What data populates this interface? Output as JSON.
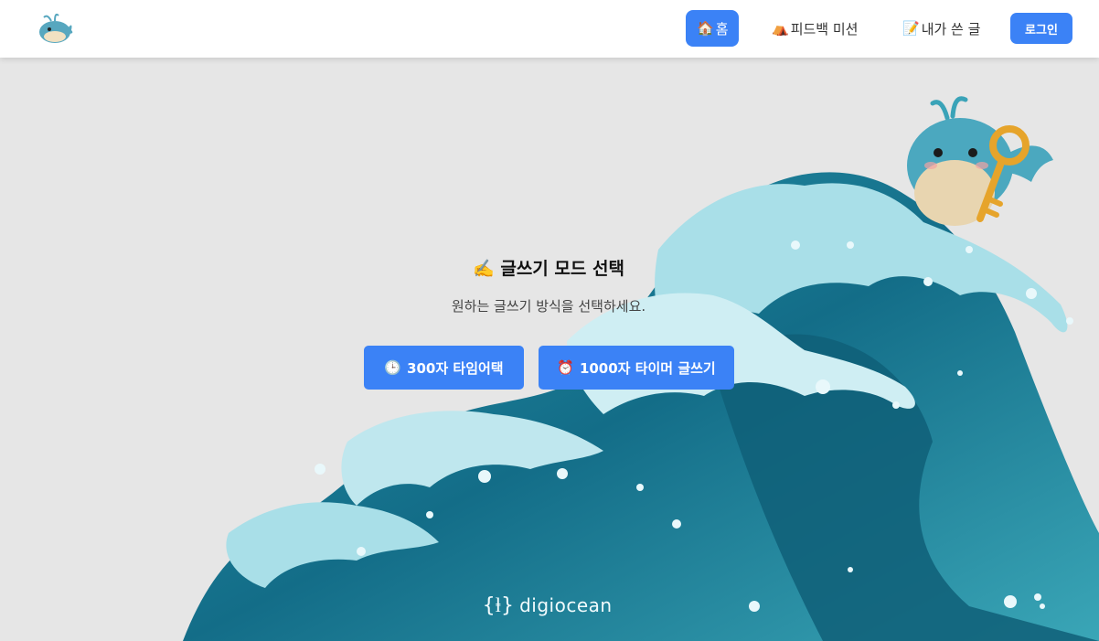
{
  "header": {
    "logo_name": "whale-logo-icon",
    "nav": [
      {
        "icon": "🏠",
        "label": "홈",
        "active": true
      },
      {
        "icon": "⛺",
        "label": "피드백 미션",
        "active": false
      },
      {
        "icon": "📝",
        "label": "내가 쓴 글",
        "active": false
      }
    ],
    "login_label": "로그인"
  },
  "main": {
    "title_icon": "✍️",
    "title": "글쓰기 모드 선택",
    "subtitle": "원하는 글쓰기 방식을 선택하세요.",
    "modes": [
      {
        "icon": "🕒",
        "label": "300자 타임어택"
      },
      {
        "icon": "⏰",
        "label": "1000자 타이머 글쓰기"
      }
    ]
  },
  "brand": {
    "name": "digiocean",
    "mark": "{ⱡ}"
  },
  "colors": {
    "accent": "#3b82f6",
    "background": "#e6e6e6",
    "wave_dark": "#0f5f78",
    "wave_mid": "#2a97ad",
    "wave_light": "#a9dfe8"
  }
}
